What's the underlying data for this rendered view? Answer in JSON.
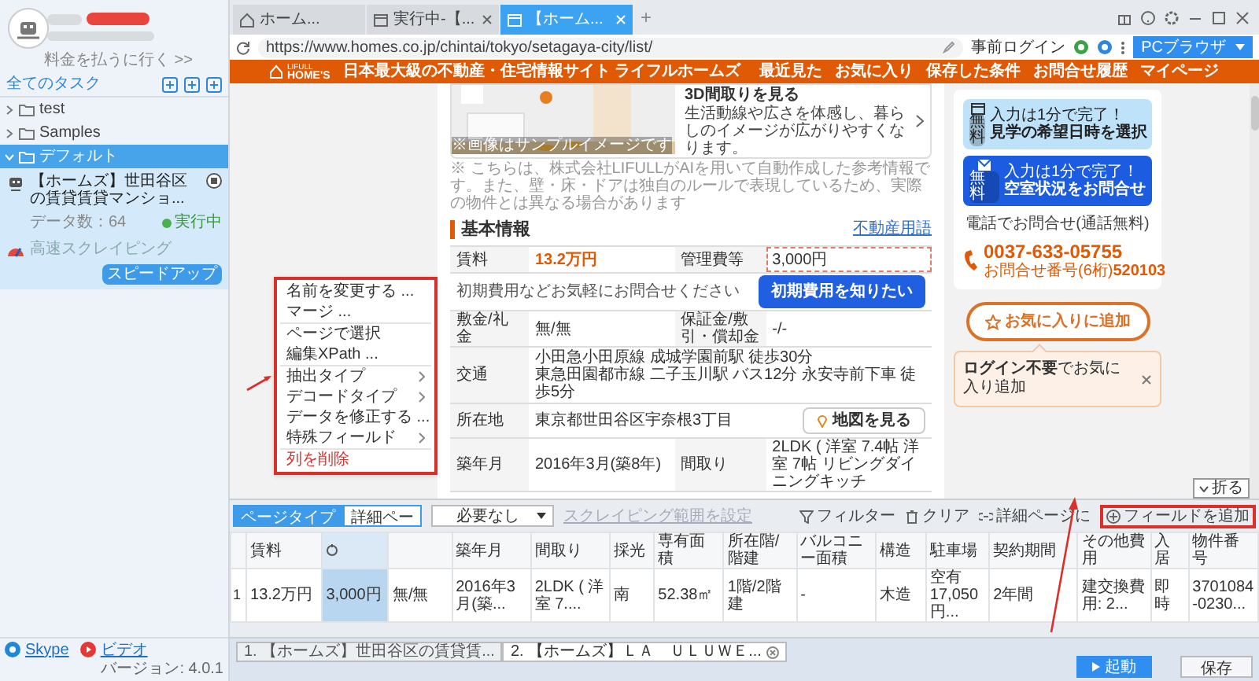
{
  "sidebar": {
    "upgrade_link": "料金を払うに行く >>",
    "all_tasks_label": "全てのタスク",
    "folders": [
      {
        "label": "test",
        "expanded": false,
        "selected": false
      },
      {
        "label": "Samples",
        "expanded": false,
        "selected": false
      },
      {
        "label": "デフォルト",
        "expanded": true,
        "selected": true,
        "children": [
          {
            "title": "【ホームズ】世田谷区の賃貸賃貸マンショ...",
            "data_count": "データ数：64",
            "status": "実行中",
            "mode": "高速スクレイピング",
            "action": "スピードアップ"
          }
        ]
      }
    ],
    "footer_links": [
      "Skype",
      "ビデオ"
    ],
    "version": "バージョン: 4.0.1"
  },
  "browser": {
    "tabs": [
      {
        "label": "ホーム...",
        "kind": "home",
        "selected": false
      },
      {
        "label": "実行中-【...",
        "kind": "page",
        "selected": false
      },
      {
        "label": "【ホーム...",
        "kind": "page",
        "selected": true
      }
    ],
    "new_tab": "+",
    "url": "https://www.homes.co.jp/chintai/tokyo/setagaya-city/list/",
    "login": "事前ログイン",
    "mode_button": "PCブラウザ"
  },
  "site_header": {
    "logo_top": "LIFULL",
    "logo": "HOME'S",
    "tagline": "日本最大級の不動産・住宅情報サイト ライフルホームズ",
    "nav": [
      "最近見た",
      "お気に入り",
      "保存した条件",
      "お問合せ履歴",
      "マイページ"
    ]
  },
  "page": {
    "tour": {
      "title": "3D間取りを見る",
      "description": "生活動線や広さを体感し、暮らしのイメージが広がりやすくなります。",
      "image_caption": "※画像はサンプルイメージです"
    },
    "note": "※ こちらは、株式会社LIFULLがAIを用いて自動作成した参考情報です。また、壁・床・ドアは独自のルールで表現しているため、実際の物件とは異なる場合があります",
    "section_title": "基本情報",
    "glossary_link": "不動産用語",
    "rows": [
      {
        "kind": "pair",
        "cells": [
          {
            "text": "賃料",
            "emphasis": false,
            "selected": false
          },
          {
            "text": "13.2万円",
            "emphasis": true,
            "selected": false
          },
          {
            "text": "管理費等",
            "emphasis": false,
            "selected": false
          },
          {
            "text": "3,000円",
            "emphasis": false,
            "selected": true
          }
        ]
      },
      {
        "kind": "cta",
        "text": "初期費用などお気軽にお問合せください",
        "button": "初期費用を知りたい"
      },
      {
        "kind": "pair",
        "cells": [
          {
            "text": "敷金/礼金",
            "emphasis": false,
            "selected": false
          },
          {
            "text": "無/無",
            "emphasis": false,
            "selected": false
          },
          {
            "text": "保証金/敷引・償却金",
            "emphasis": false,
            "selected": false
          },
          {
            "text": "-/-",
            "emphasis": false,
            "selected": false
          }
        ]
      },
      {
        "kind": "lines",
        "label": "交通",
        "lines": [
          "小田急小田原線 成城学園前駅 徒歩30分",
          "東急田園都市線 二子玉川駅 バス12分 永安寺前下車 徒歩5分"
        ]
      },
      {
        "kind": "map",
        "label": "所在地",
        "value": "東京都世田谷区宇奈根3丁目",
        "button": "地図を見る"
      },
      {
        "kind": "pair",
        "cells": [
          {
            "text": "築年月",
            "emphasis": false,
            "selected": false
          },
          {
            "text": "2016年3月(築8年)",
            "emphasis": false,
            "selected": false
          },
          {
            "text": "間取り",
            "emphasis": false,
            "selected": false
          },
          {
            "text": "2LDK ( 洋室 7.4帖 洋室 7帖 リビングダイニングキッチ",
            "emphasis": false,
            "selected": false
          }
        ]
      }
    ],
    "contact": {
      "buttons": [
        {
          "kind": "light",
          "badge": "無料",
          "small": "入力は1分で完了！",
          "label": "見学の希望日時を選択"
        },
        {
          "kind": "dark",
          "badge": "無料",
          "small": "入力は1分で完了！",
          "label": "空室状況をお問合せ"
        }
      ],
      "phone_label": "電話でお問合せ(通話無料)",
      "phone": "0037-633-05755",
      "inquiry": "お問合せ番号(6桁)**520103**"
    },
    "favorite_button": "お気に入りに追加",
    "tooltip": "**ログイン不要**でお気に入り追加",
    "collapse_button": "折る"
  },
  "context_menu": {
    "groups": [
      [
        {
          "label": "名前を変更する ...",
          "kind": "action"
        },
        {
          "label": "マージ ...",
          "kind": "action"
        }
      ],
      [
        {
          "label": "ページで選択",
          "kind": "action"
        },
        {
          "label": "編集XPath ...",
          "kind": "action"
        }
      ],
      [
        {
          "label": "抽出タイプ",
          "kind": "submenu"
        },
        {
          "label": "デコードタイプ",
          "kind": "submenu"
        },
        {
          "label": "データを修正する ...",
          "kind": "action"
        },
        {
          "label": "特殊フィールド",
          "kind": "submenu"
        }
      ],
      [
        {
          "label": "列を削除",
          "kind": "danger"
        }
      ]
    ]
  },
  "panel": {
    "page_types": [
      {
        "label": "ページタイプ",
        "selected": true
      },
      {
        "label": "詳細ペー",
        "selected": false
      }
    ],
    "dropdown": "必要なし",
    "range_link": "スクレイピング範囲を設定",
    "actions": [
      {
        "label": "フィルター",
        "kind": "filter"
      },
      {
        "label": "クリア",
        "kind": "clear"
      },
      {
        "label": "詳細ページに",
        "kind": "link"
      }
    ],
    "add_field": "フィールドを追加",
    "columns": [
      {
        "label": "賃料",
        "selected": false
      },
      {
        "selected": true
      },
      {
        "selected": false
      },
      {
        "label": "築年月",
        "selected": false
      },
      {
        "label": "間取り",
        "selected": false
      },
      {
        "label": "採光",
        "selected": false
      },
      {
        "label": "専有面積",
        "selected": false
      },
      {
        "label": "所在階/階建",
        "selected": false
      },
      {
        "label": "バルコニー面積",
        "selected": false
      },
      {
        "label": "構造",
        "selected": false
      },
      {
        "label": "駐車場",
        "selected": false
      },
      {
        "label": "契約期間",
        "selected": false
      },
      {
        "label": "その他費用",
        "selected": false
      },
      {
        "label": "入居",
        "selected": false
      },
      {
        "label": "物件番号",
        "selected": false
      }
    ],
    "rows": [
      {
        "number": "1",
        "cells": [
          "13.2万円",
          "3,000円",
          "無/無",
          "2016年3月(築...",
          "2LDK ( 洋室 7....",
          "南",
          "52.38㎡",
          "1階/2階建",
          "-",
          "木造",
          "空有 17,050円...",
          "2年間",
          "建交換費用: 2...",
          "即時",
          "3701084-0230..."
        ]
      }
    ]
  },
  "run_tabs": [
    {
      "label": "1. 【ホームズ】世田谷区の賃貸賃...",
      "selected": false
    },
    {
      "label": "2. 【ホームズ】ＬＡ　ＵＬＵＷＥ...",
      "selected": true
    }
  ],
  "start_button": "起動",
  "save_button": "保存"
}
